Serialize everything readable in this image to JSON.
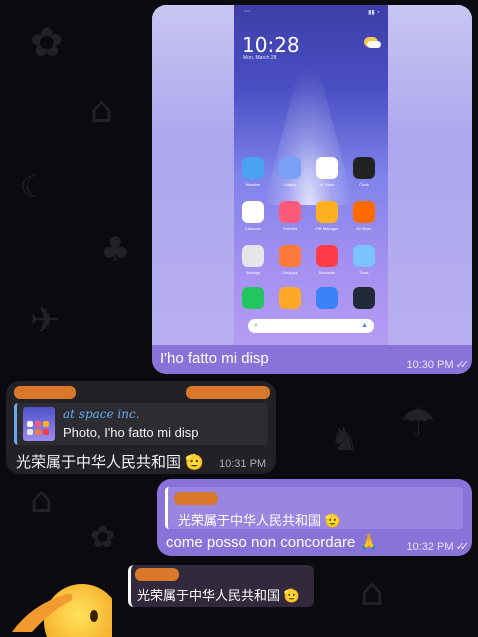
{
  "photo_message": {
    "caption": "I'ho fatto mi disp",
    "time": "10:30 PM",
    "read_ticks": "✓✓",
    "screenshot": {
      "clock": "10:28",
      "date": "Mon, March 28",
      "apps": [
        {
          "label": "Weather",
          "color": "#4aa3f0"
        },
        {
          "label": "Gallery",
          "color": "#7aa0f5"
        },
        {
          "label": "Hi Video",
          "color": "#ffffff"
        },
        {
          "label": "Clock",
          "color": "#222222"
        },
        {
          "label": "Calendar",
          "color": "#ffffff"
        },
        {
          "label": "Themes",
          "color": "#ff5a7a"
        },
        {
          "label": "File Manager",
          "color": "#ffb020"
        },
        {
          "label": "Mi Store",
          "color": "#ff6a00"
        },
        {
          "label": "Settings",
          "color": "#e6e6ea"
        },
        {
          "label": "GetApps",
          "color": "#ff7a3a"
        },
        {
          "label": "Recorder",
          "color": "#ff3b48"
        },
        {
          "label": "Tools",
          "color": "#7cc2ff"
        },
        {
          "label": "",
          "color": "#22c55e"
        },
        {
          "label": "",
          "color": "#ffa726"
        },
        {
          "label": "",
          "color": "#3b82f6"
        },
        {
          "label": "",
          "color": "#1f2937"
        }
      ]
    }
  },
  "incoming_message": {
    "reply_to": {
      "sender_label": "at space inc.",
      "text": "Photo, I'ho fatto mi disp"
    },
    "text": "光荣属于中华人民共和国 🫡",
    "time": "10:31 PM"
  },
  "outgoing_reply": {
    "reply_to_text": "光荣属于中华人民共和国 🫡",
    "text": "come posso non concordare 🙏",
    "time": "10:32 PM",
    "read_ticks": "✓✓"
  },
  "sticker_message": {
    "sticker_emoji": "🫡",
    "reply_to_text": "光荣属于中华人民共和国 🫡"
  },
  "colors": {
    "outgoing_bubble": "#8a73d8",
    "incoming_bubble": "#222126",
    "redaction": "#d9782a",
    "reply_accent": "#6aa8f0",
    "background": "#0b0a0e"
  }
}
